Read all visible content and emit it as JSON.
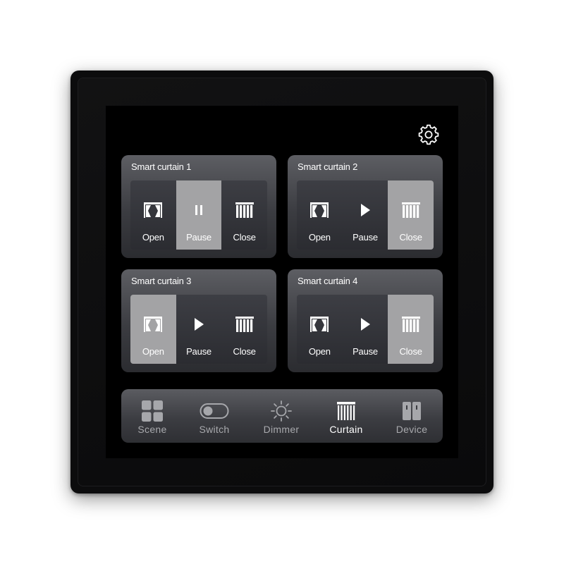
{
  "settings": {
    "icon": "gear-icon"
  },
  "controls": {
    "open": "Open",
    "pause": "Pause",
    "close": "Close"
  },
  "curtains": [
    {
      "title": "Smart curtain 1",
      "active": "pause",
      "paused": true
    },
    {
      "title": "Smart curtain 2",
      "active": "close",
      "paused": false
    },
    {
      "title": "Smart curtain 3",
      "active": "open",
      "paused": false
    },
    {
      "title": "Smart curtain 4",
      "active": "close",
      "paused": false
    }
  ],
  "nav": {
    "active": "curtain",
    "items": [
      {
        "id": "scene",
        "label": "Scene",
        "icon": "scene-grid-icon"
      },
      {
        "id": "switch",
        "label": "Switch",
        "icon": "toggle-switch-icon"
      },
      {
        "id": "dimmer",
        "label": "Dimmer",
        "icon": "sun-icon"
      },
      {
        "id": "curtain",
        "label": "Curtain",
        "icon": "curtain-icon"
      },
      {
        "id": "device",
        "label": "Device",
        "icon": "device-icon"
      }
    ]
  },
  "colors": {
    "active_button": "#a3a3a5",
    "screen": "#000000",
    "text": "#ffffff",
    "nav_inactive_text": "#a8a9ad"
  }
}
